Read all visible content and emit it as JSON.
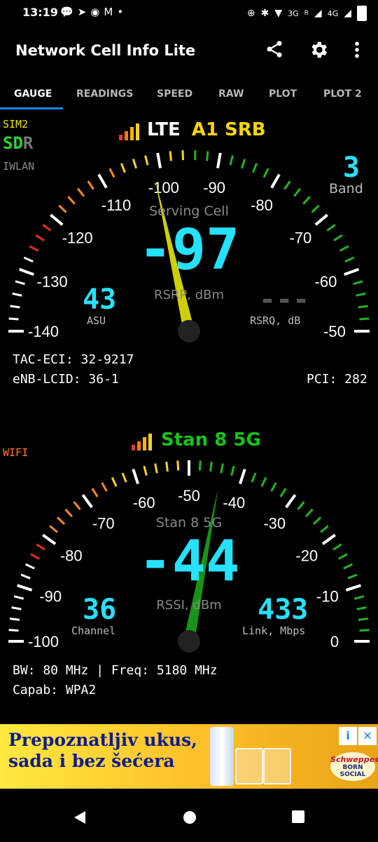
{
  "statusbar": {
    "time": "13:19",
    "network_3g": "3G",
    "network_4g": "4G",
    "roaming": "R"
  },
  "appbar": {
    "title": "Network Cell Info Lite"
  },
  "tabs": [
    "GAUGE",
    "READINGS",
    "SPEED",
    "RAW",
    "PLOT",
    "PLOT 2"
  ],
  "active_tab": 0,
  "cell": {
    "sim": "SIM2",
    "sdr": [
      "S",
      "D",
      "R"
    ],
    "iwlan": "IWLAN",
    "tech": "LTE",
    "operator": "A1 SRB",
    "band_display": "3",
    "band_label": "Band",
    "gauge_label": "Serving Cell",
    "rsrp_display": "-97",
    "rsrp_value": -97,
    "rsrp_unit": "RSRP, dBm",
    "asu_display": "43",
    "asu_label": "ASU",
    "rsrq_display": "---",
    "rsrq_label": "RSRQ, dB",
    "scale_labels": [
      "-140",
      "-130",
      "-120",
      "-110",
      "-100",
      "-90",
      "-80",
      "-70",
      "-60",
      "-50"
    ],
    "scale_min": -140,
    "scale_max": -40,
    "tac_eci": "TAC-ECI: 32-9217",
    "enb_lcid": "eNB-LCID: 36-1",
    "pci": "PCI: 282"
  },
  "wifi": {
    "label": "WIFI",
    "ssid": "Stan 8 5G",
    "gauge_label": "Stan 8 5G",
    "rssi_display": "-44",
    "rssi_value": -44,
    "rssi_unit": "RSSI, dBm",
    "channel_display": "36",
    "channel_label": "Channel",
    "link_display": "433",
    "link_label": "Link, Mbps",
    "scale_labels": [
      "-100",
      "-90",
      "-80",
      "-70",
      "-60",
      "-50",
      "-40",
      "-30",
      "-20",
      "-10",
      "0"
    ],
    "scale_min": -100,
    "scale_max": 0,
    "bw_freq": "BW: 80 MHz | Freq: 5180 MHz",
    "capab": "Capab: WPA2"
  },
  "ad": {
    "line1": "Prepoznatljiv ukus,",
    "line2": "sada i bez šećera",
    "brand": "Schweppes",
    "brand_sub1": "BORN",
    "brand_sub2": "SOCIAL"
  },
  "colors": {
    "accent_tab": "#1e88e5",
    "digits": "#26e1ff",
    "needle_cell": "#e4e600",
    "needle_wifi": "#1aa41a",
    "operator": "#ffd500",
    "ssid": "#17c317"
  },
  "icons": [
    "share-icon",
    "gear-icon",
    "more-vert-icon",
    "back-icon",
    "home-icon",
    "recents-icon"
  ]
}
